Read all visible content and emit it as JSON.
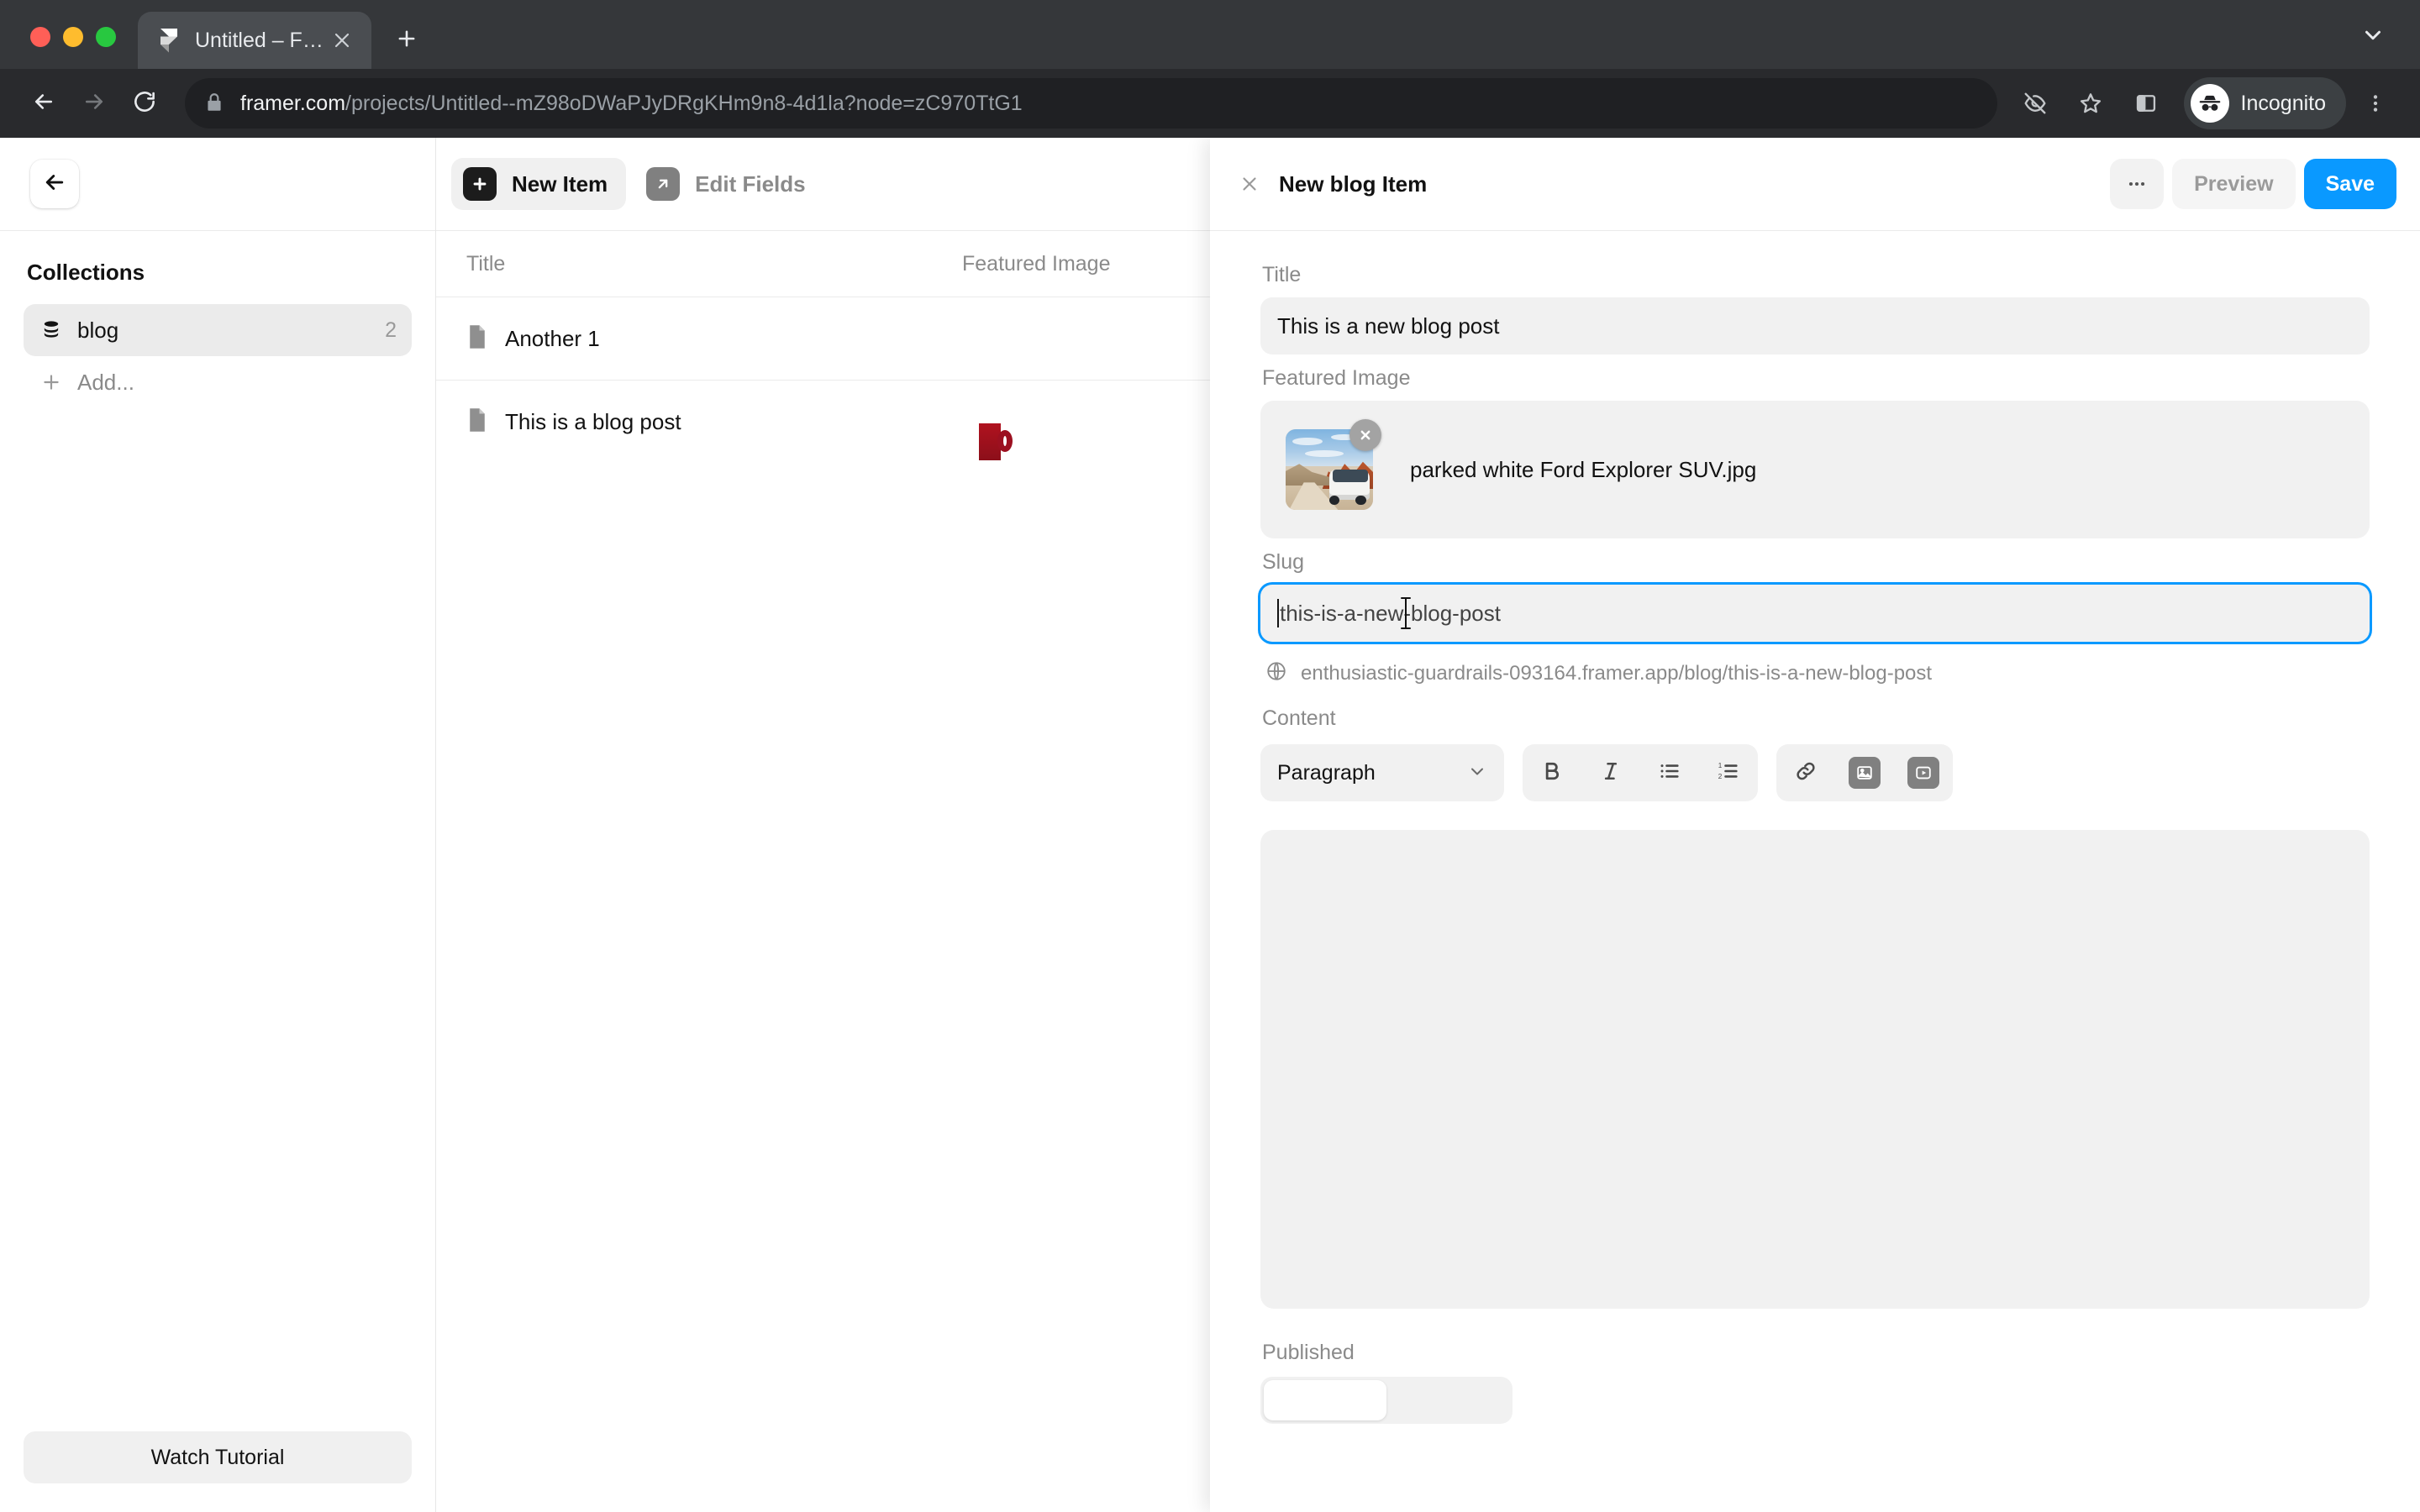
{
  "browser": {
    "tab": {
      "title": "Untitled – Framer",
      "favicon_icon": "framer-logo-icon",
      "close_icon": "close-icon"
    },
    "new_tab_icon": "plus-icon",
    "tabstrip_chevron_icon": "chevron-down-icon",
    "back_icon": "arrow-left-icon",
    "forward_icon": "arrow-right-icon",
    "reload_icon": "reload-icon",
    "omnibox": {
      "lock_icon": "lock-icon",
      "url_domain": "framer.com",
      "url_path": "/projects/Untitled--mZ98oDWaPJyDRgKHm9n8-4d1la?node=zC970TtG1"
    },
    "toolbar_icons": [
      "eye-off-icon",
      "star-icon",
      "side-panel-icon"
    ],
    "profile": {
      "label": "Incognito",
      "icon": "incognito-icon"
    },
    "menu_icon": "three-dots-vertical-icon"
  },
  "sidebar": {
    "back_icon": "arrow-left-icon",
    "heading": "Collections",
    "items": [
      {
        "label": "blog",
        "count": "2",
        "icon": "database-icon",
        "active": true
      }
    ],
    "add": {
      "label": "Add...",
      "icon": "plus-icon"
    },
    "watch_tutorial": "Watch Tutorial"
  },
  "middle": {
    "toolbar": {
      "new_item": {
        "label": "New Item",
        "icon": "plus-square-icon"
      },
      "edit_fields": {
        "label": "Edit Fields",
        "icon": "arrow-up-right-square-icon"
      }
    },
    "columns": [
      "Title",
      "Featured Image"
    ],
    "rows": [
      {
        "icon": "document-icon",
        "title": "Another 1",
        "thumb": "empty"
      },
      {
        "icon": "document-icon",
        "title": "This is a blog post",
        "thumb": "red-mug"
      }
    ]
  },
  "panel": {
    "close_icon": "close-icon",
    "title": "New blog Item",
    "more_label": "•••",
    "preview_label": "Preview",
    "save_label": "Save",
    "accent_color": "#0a99ff",
    "fields": {
      "title": {
        "label": "Title",
        "value": "This is a new blog post"
      },
      "featured_image": {
        "label": "Featured Image",
        "file_name": "parked white Ford Explorer SUV.jpg",
        "remove_icon": "close-circle-icon",
        "thumb": "desert-suv-photo"
      },
      "slug": {
        "label": "Slug",
        "value": "this-is-a-new-blog-post",
        "focused": true,
        "preview_icon": "globe-icon",
        "preview_url": "enthusiastic-guardrails-093164.framer.app/blog/this-is-a-new-blog-post"
      },
      "content": {
        "label": "Content",
        "style_select": {
          "value": "Paragraph",
          "chevron_icon": "chevron-down-icon"
        },
        "buttons": [
          {
            "name": "bold",
            "glyph": "B",
            "icon": "bold-icon"
          },
          {
            "name": "italic",
            "glyph": "I",
            "icon": "italic-icon"
          },
          {
            "name": "bulleted-list",
            "glyph": "",
            "icon": "bulleted-list-icon"
          },
          {
            "name": "numbered-list",
            "glyph": "",
            "icon": "numbered-list-icon"
          },
          {
            "name": "link",
            "glyph": "",
            "icon": "link-icon"
          },
          {
            "name": "image",
            "glyph": "",
            "icon": "image-icon"
          },
          {
            "name": "video",
            "glyph": "",
            "icon": "video-icon"
          }
        ],
        "body": ""
      },
      "published": {
        "label": "Published",
        "options": [
          "",
          ""
        ],
        "selected_index": 0
      }
    }
  }
}
